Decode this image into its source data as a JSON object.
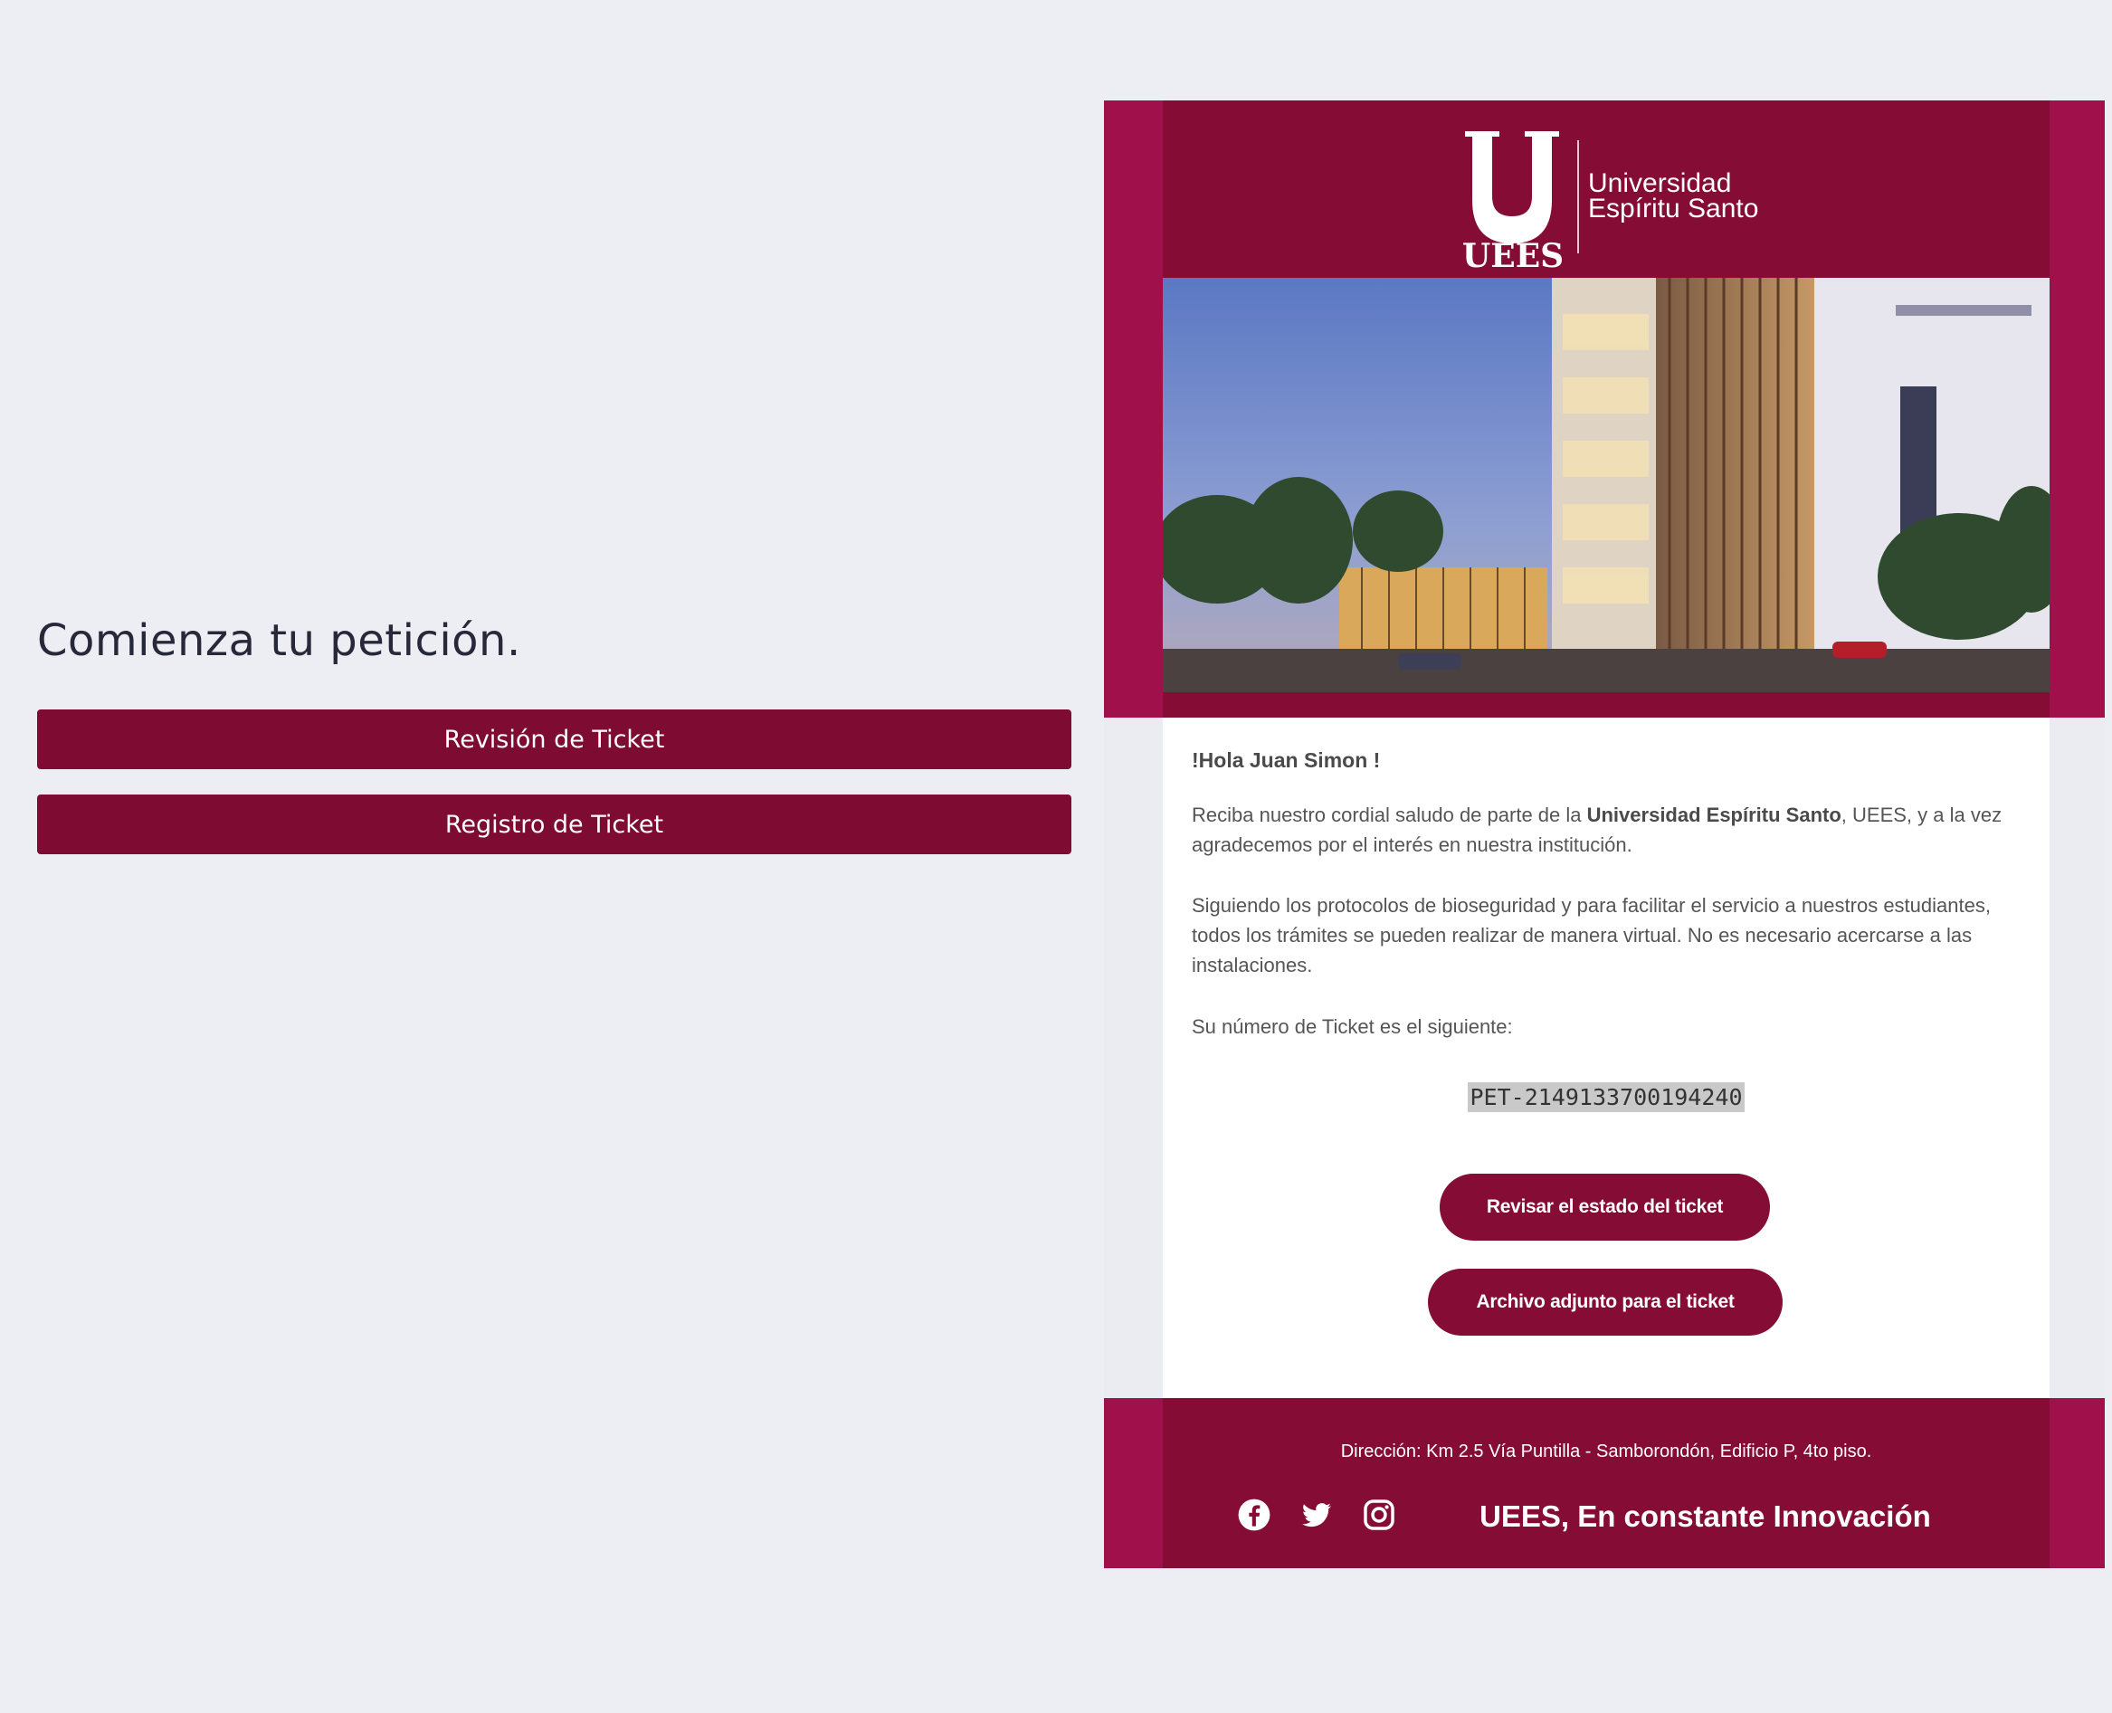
{
  "left": {
    "heading": "Comienza tu petición.",
    "buttons": {
      "review": "Revisión de Ticket",
      "register": "Registro de Ticket"
    }
  },
  "email": {
    "logo": {
      "mark": "UEES",
      "line1": "Universidad",
      "line2": "Espíritu Santo"
    },
    "greeting": "!Hola Juan Simon !",
    "para1_before": "Reciba nuestro cordial saludo de parte de la ",
    "para1_bold": "Universidad Espíritu Santo",
    "para1_after": ", UEES, y a la vez agradecemos por el interés en nuestra institución.",
    "para2": "Siguiendo los protocolos de bioseguridad y para facilitar el servicio a nuestros estudiantes, todos los trámites se pueden realizar de manera virtual. No es necesario acercarse a las instalaciones.",
    "para3": "Su número de Ticket es el siguiente:",
    "ticket_number": "PET-2149133700194240",
    "btn_status": "Revisar el estado del ticket",
    "btn_attach": "Archivo adjunto para el ticket",
    "footer": {
      "address": "Dirección: Km 2.5 Vía Puntilla - Samborondón, Edificio P, 4to piso.",
      "slogan": "UEES, En constante Innovación",
      "icons": [
        "facebook-icon",
        "twitter-icon",
        "instagram-icon"
      ]
    }
  },
  "colors": {
    "background": "#edeef3",
    "brand": "#850c34",
    "brand_accent": "#a0104a",
    "button": "#7d0b32"
  }
}
